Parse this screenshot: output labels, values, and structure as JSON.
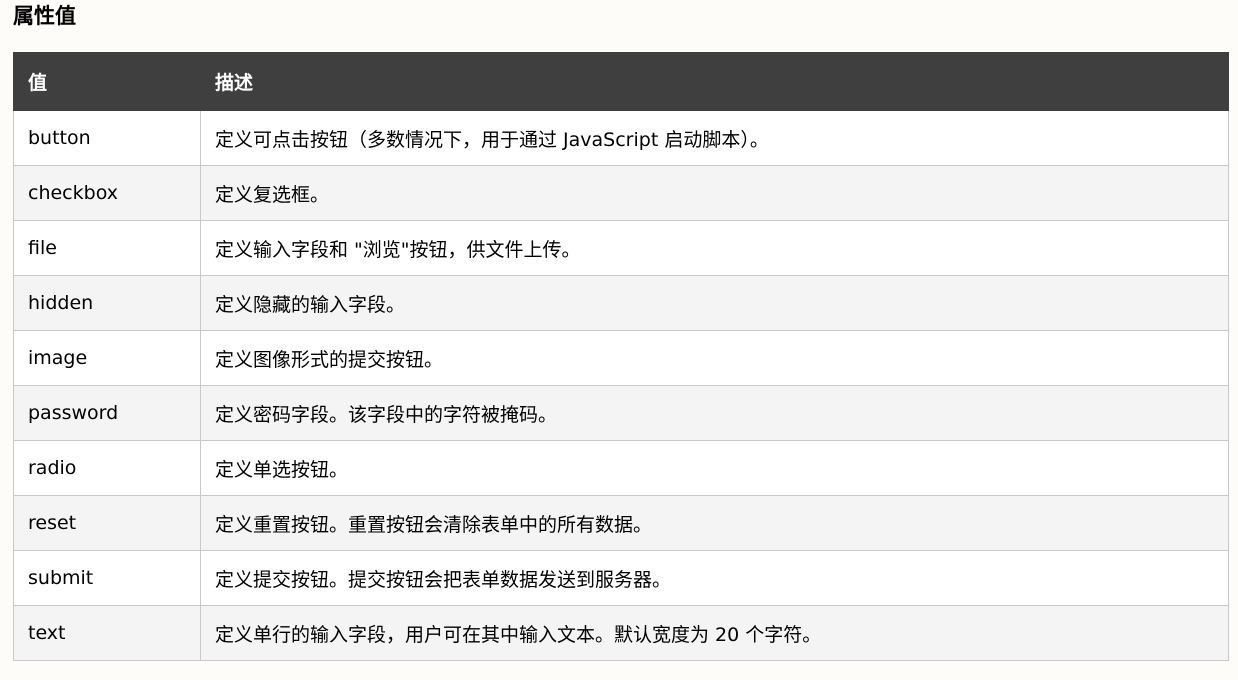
{
  "section": {
    "title": "属性值"
  },
  "table": {
    "headers": {
      "value": "值",
      "description": "描述"
    },
    "rows": [
      {
        "value": "button",
        "description": "定义可点击按钮（多数情况下，用于通过 JavaScript 启动脚本）。"
      },
      {
        "value": "checkbox",
        "description": "定义复选框。"
      },
      {
        "value": "file",
        "description": "定义输入字段和 \"浏览\"按钮，供文件上传。"
      },
      {
        "value": "hidden",
        "description": "定义隐藏的输入字段。"
      },
      {
        "value": "image",
        "description": "定义图像形式的提交按钮。"
      },
      {
        "value": "password",
        "description": "定义密码字段。该字段中的字符被掩码。"
      },
      {
        "value": "radio",
        "description": "定义单选按钮。"
      },
      {
        "value": "reset",
        "description": "定义重置按钮。重置按钮会清除表单中的所有数据。"
      },
      {
        "value": "submit",
        "description": "定义提交按钮。提交按钮会把表单数据发送到服务器。"
      },
      {
        "value": "text",
        "description": "定义单行的输入字段，用户可在其中输入文本。默认宽度为 20 个字符。"
      }
    ]
  },
  "colors": {
    "header_bg": "#3f3f3f",
    "header_text": "#ffffff",
    "row_odd": "#ffffff",
    "row_even": "#f4f4f4",
    "border": "#c8c8c8",
    "page_bg": "#fdfcf8"
  }
}
